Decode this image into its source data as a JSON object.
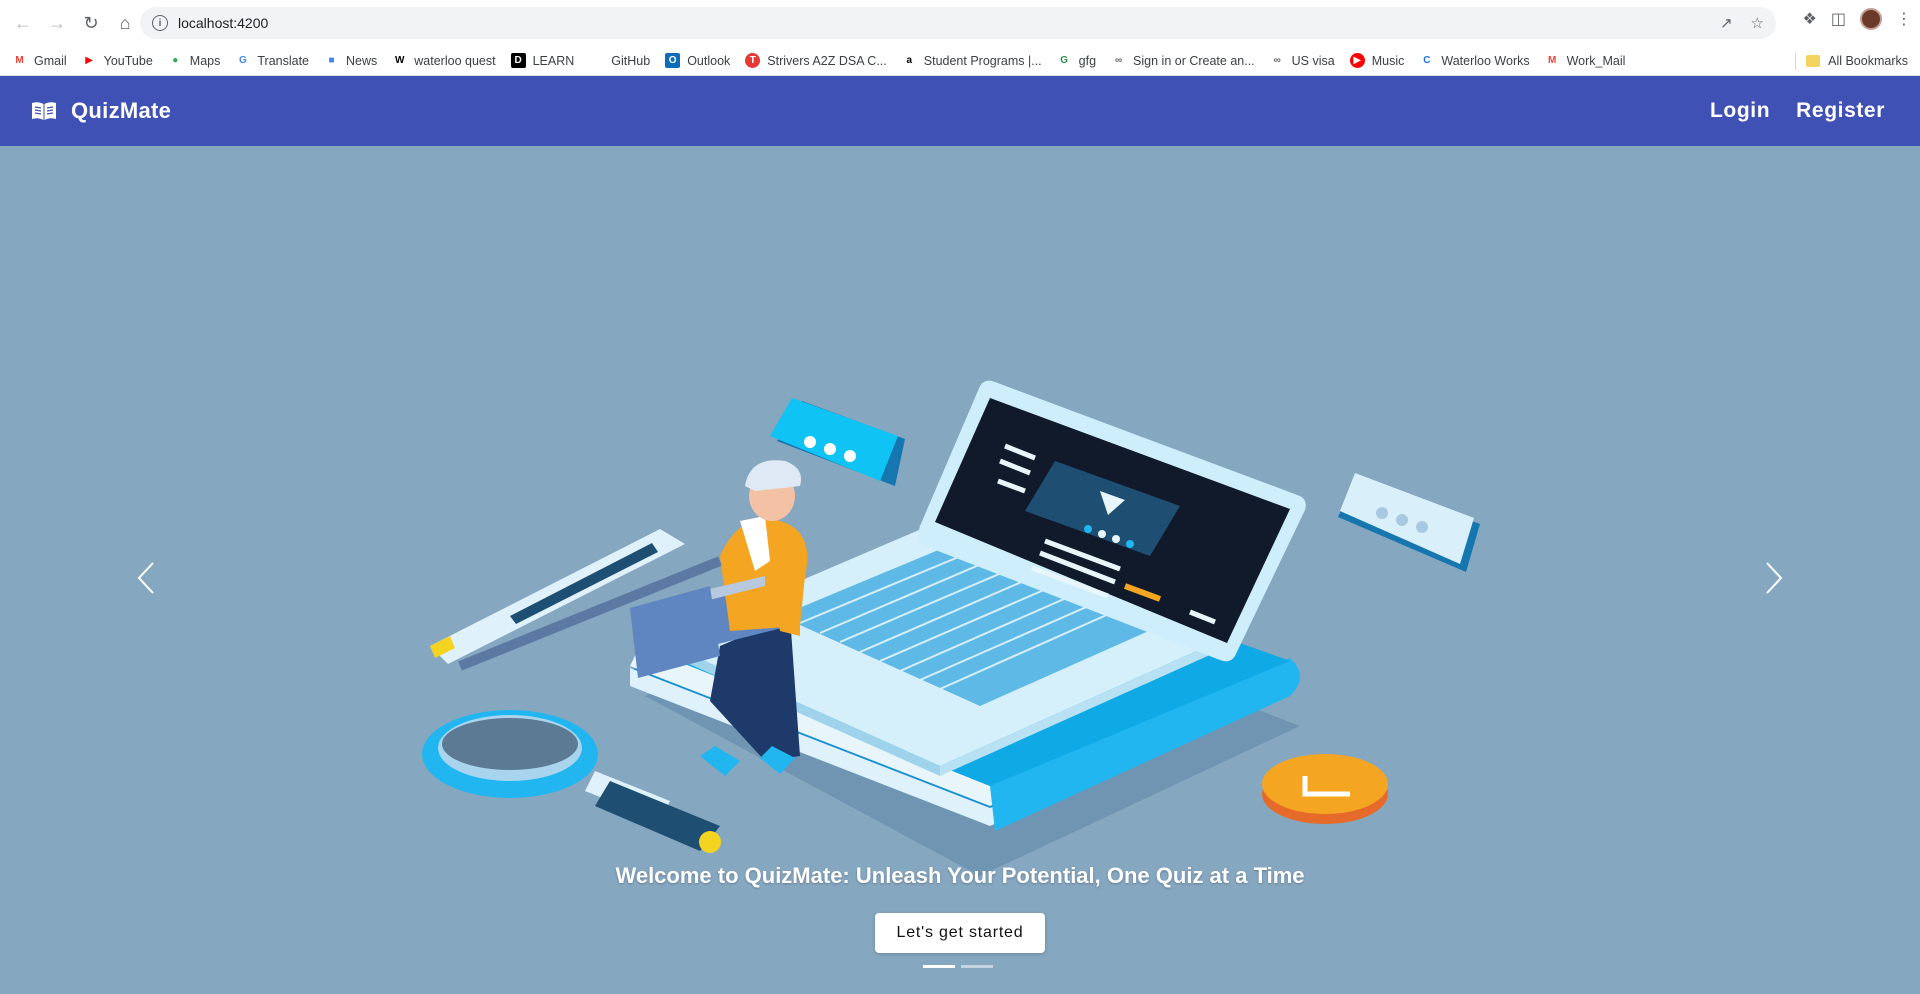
{
  "browser": {
    "url": "localhost:4200",
    "bookmarks": [
      {
        "label": "Gmail",
        "icon": "gmail-icon",
        "color": "#ea4335"
      },
      {
        "label": "YouTube",
        "icon": "youtube-icon",
        "color": "#ff0000"
      },
      {
        "label": "Maps",
        "icon": "maps-icon",
        "color": "#34a853"
      },
      {
        "label": "Translate",
        "icon": "translate-icon",
        "color": "#4285f4"
      },
      {
        "label": "News",
        "icon": "news-icon",
        "color": "#4285f4"
      },
      {
        "label": "waterloo quest",
        "icon": "waterloo-icon",
        "color": "#000000"
      },
      {
        "label": "LEARN",
        "icon": "d2l-icon",
        "color": "#000000"
      },
      {
        "label": "GitHub",
        "icon": "github-icon",
        "color": "#ffffff"
      },
      {
        "label": "Outlook",
        "icon": "outlook-icon",
        "color": "#0f6cbd"
      },
      {
        "label": "Strivers A2Z DSA C...",
        "icon": "tuf-icon",
        "color": "#e53935"
      },
      {
        "label": "Student Programs |...",
        "icon": "amazon-icon",
        "color": "#000000"
      },
      {
        "label": "gfg",
        "icon": "gfg-icon",
        "color": "#2f8d46"
      },
      {
        "label": "Sign in or Create an...",
        "icon": "link-icon",
        "color": "#5f6368"
      },
      {
        "label": "US visa",
        "icon": "link-icon",
        "color": "#5f6368"
      },
      {
        "label": "Music",
        "icon": "music-icon",
        "color": "#ff0000"
      },
      {
        "label": "Waterloo Works",
        "icon": "waterloo-works-icon",
        "color": "#1a73e8"
      },
      {
        "label": "Work_Mail",
        "icon": "gmail-icon",
        "color": "#ea4335"
      }
    ],
    "all_bookmarks_label": "All Bookmarks"
  },
  "toolbar": {
    "brand": "QuizMate",
    "login_label": "Login",
    "register_label": "Register",
    "color": "#3f51b5"
  },
  "carousel": {
    "caption": "Welcome to QuizMate: Unleash Your Potential, One Quiz at a Time",
    "cta_label": "Let's get started",
    "slide_count": 2,
    "active_slide": 1,
    "background": "#86a7c0"
  }
}
